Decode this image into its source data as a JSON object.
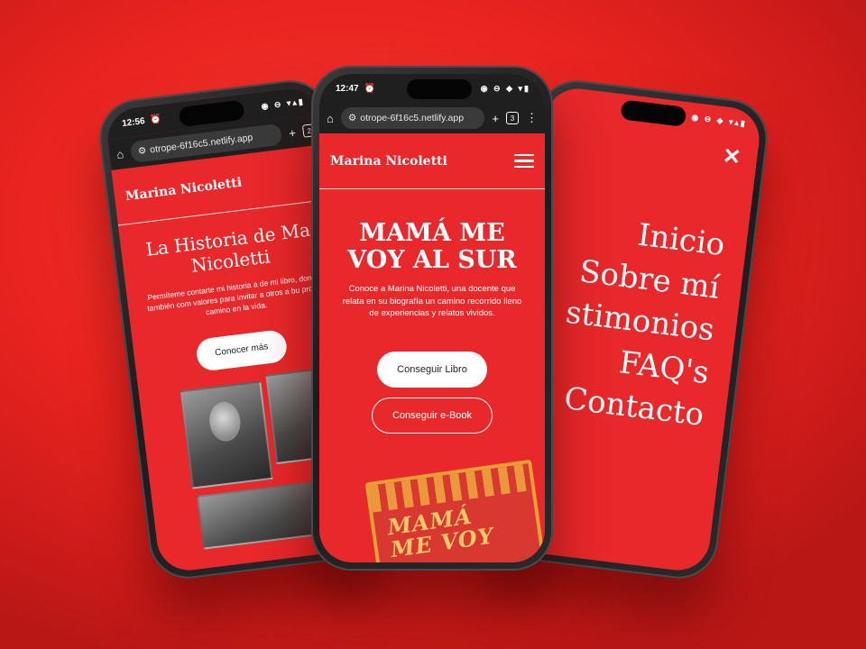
{
  "brand": "Marina Nicoletti",
  "center": {
    "time": "12:47",
    "url": "otrope-6f16c5.netlify.app",
    "tab_count": "3",
    "hero_title_line1": "MAMÁ ME",
    "hero_title_line2": "VOY AL SUR",
    "hero_text": "Conoce a Marina Nicoletti, una docente que relata en su biografía un camino recorrido lleno de experiencias y relatos vividos.",
    "primary_button": "Conseguir Libro",
    "secondary_button": "Conseguir e-Book",
    "book_title_line1": "MAMÁ",
    "book_title_line2": "ME VOY"
  },
  "left": {
    "time": "12:56",
    "url": "otrope-6f16c5.netlify.app",
    "tab_count": "2",
    "title_line1": "La Historia de Ma",
    "title_line2": "Nicoletti",
    "text": "Permíteme contarte mi historia a de mi libro, donde también com valores para invitar a otros a bu propio camino en la vida.",
    "button": "Conocer más"
  },
  "right": {
    "menu_items": [
      "Inicio",
      "Sobre mí",
      "stimonios",
      "FAQ's",
      "Contacto"
    ]
  },
  "colors": {
    "accent": "#e8282a",
    "background": "#ea2420",
    "phone_frame": "#1c1c1e"
  },
  "icons": [
    "home-icon",
    "site-settings-icon",
    "add-tab-icon",
    "tabs-icon",
    "more-icon",
    "alarm-icon",
    "wifi-icon",
    "battery-icon",
    "menu-icon",
    "close-icon"
  ]
}
